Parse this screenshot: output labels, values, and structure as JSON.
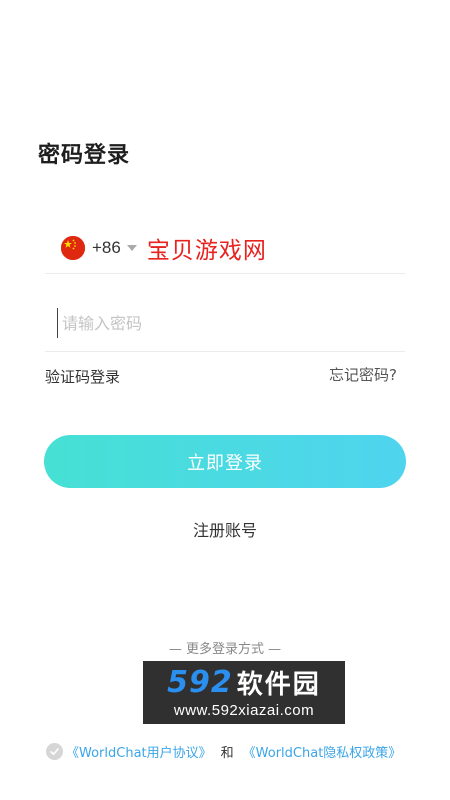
{
  "login": {
    "title": "密码登录",
    "country_code": "+86",
    "phone_value": "宝贝游戏网",
    "password_placeholder": "请输入密码",
    "sms_login_label": "验证码登录",
    "forgot_label": "忘记密码?",
    "submit_label": "立即登录",
    "register_label": "注册账号",
    "more_methods_label": "— 更多登录方式 —"
  },
  "watermark": {
    "numbers": "592",
    "brand": "软件园",
    "url": "www.592xiazai.com"
  },
  "agreement": {
    "user_agreement": "《WorldChat用户协议》",
    "and": "和",
    "privacy_policy": "《WorldChat隐私权政策》"
  },
  "colors": {
    "accent_gradient_start": "#46e0d4",
    "accent_gradient_end": "#4fd4ef",
    "link": "#3ba5e8",
    "phone_value_red": "#e8231f"
  },
  "icons": {
    "flag": "china-flag-icon",
    "caret": "caret-down-icon",
    "check": "check-circle-icon"
  }
}
